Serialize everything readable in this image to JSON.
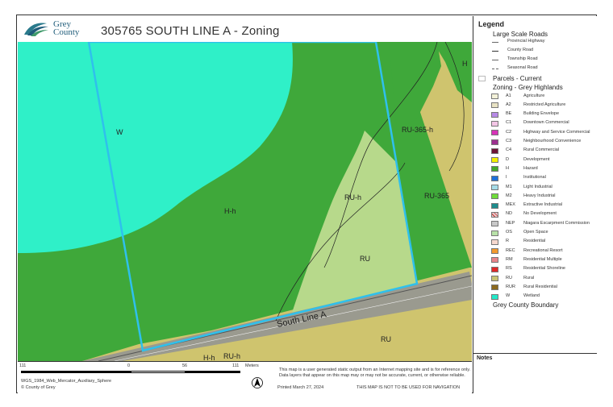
{
  "header": {
    "title": "305765 SOUTH LINE A - Zoning",
    "logo_text": [
      "Grey",
      "County"
    ]
  },
  "map": {
    "labels": {
      "w": "W",
      "hh": "H-h",
      "ruh_center": "RU-h",
      "ru_center": "RU",
      "ru365h": "RU-365-h",
      "ru365": "RU-365",
      "ru_south": "RU",
      "h_top_right": "H",
      "road": "South Line A",
      "bottom_h": "H-h",
      "bottom_ruh": "RU-h"
    }
  },
  "legend": {
    "title": "Legend",
    "roads_heading": "Large Scale Roads",
    "roads": [
      {
        "label": "Provincial Highway"
      },
      {
        "label": "County Road"
      },
      {
        "label": "Township Road"
      },
      {
        "label": "Seasonal Road"
      }
    ],
    "parcels_label": "Parcels - Current",
    "zoning_heading": "Zoning - Grey Highlands",
    "zones": [
      {
        "code": "A1",
        "label": "Agriculture",
        "color": "#f3f1d9"
      },
      {
        "code": "A2",
        "label": "Restricted Agriculture",
        "color": "#e8e2c3"
      },
      {
        "code": "BE",
        "label": "Building Envelope",
        "color": "#b78ae6"
      },
      {
        "code": "C1",
        "label": "Downtown Commercial",
        "color": "#f3c6e6"
      },
      {
        "code": "C2",
        "label": "Highway and Service Commercial",
        "color": "#d633b8"
      },
      {
        "code": "C3",
        "label": "Neighbourhood Convenience",
        "color": "#9c2f8f"
      },
      {
        "code": "C4",
        "label": "Rural Commercial",
        "color": "#6e1435"
      },
      {
        "code": "D",
        "label": "Development",
        "color": "#f5f000"
      },
      {
        "code": "H",
        "label": "Hazard",
        "color": "#43a82b"
      },
      {
        "code": "I",
        "label": "Institutional",
        "color": "#1e6fd9"
      },
      {
        "code": "M1",
        "label": "Light Industrial",
        "color": "#a6dce8"
      },
      {
        "code": "M2",
        "label": "Heavy Industrial",
        "color": "#6fdc3a"
      },
      {
        "code": "MEX",
        "label": "Extractive Industrial",
        "color": "#1e8c8c"
      },
      {
        "code": "ND",
        "label": "No Development",
        "color": "#e9c8cf"
      },
      {
        "code": "NEP",
        "label": "Niagara Escarpment Commission",
        "color": "#c8c8c8"
      },
      {
        "code": "OS",
        "label": "Open Space",
        "color": "#b8e2a8"
      },
      {
        "code": "R",
        "label": "Residential",
        "color": "#f7d9cf"
      },
      {
        "code": "REC",
        "label": "Recreational Resort",
        "color": "#f29a2e"
      },
      {
        "code": "RM",
        "label": "Residential Multiple",
        "color": "#e8848a"
      },
      {
        "code": "RS",
        "label": "Residential Shoreline",
        "color": "#e02828"
      },
      {
        "code": "RU",
        "label": "Rural",
        "color": "#c8c372"
      },
      {
        "code": "RUR",
        "label": "Rural Residential",
        "color": "#8c6a1e"
      },
      {
        "code": "W",
        "label": "Wetland",
        "color": "#22e8c8"
      }
    ],
    "boundary_label": "Grey County Boundary",
    "notes_title": "Notes"
  },
  "footer": {
    "scale": {
      "left": "111",
      "zero": "0",
      "mid": "56",
      "right": "111",
      "unit": "Meters"
    },
    "projection": "WGS_1984_Web_Mercator_Auxiliary_Sphere",
    "copyright": "© County of Grey",
    "disclaimer": "This map is a user generated static output from an Internet mapping site and is for reference only. Data layers that appear on this map may or may not be accurate, current, or otherwise reliable.",
    "printed": "Printed March 27, 2024",
    "nav_warning": "THIS MAP IS NOT TO BE USED FOR NAVIGATION"
  }
}
